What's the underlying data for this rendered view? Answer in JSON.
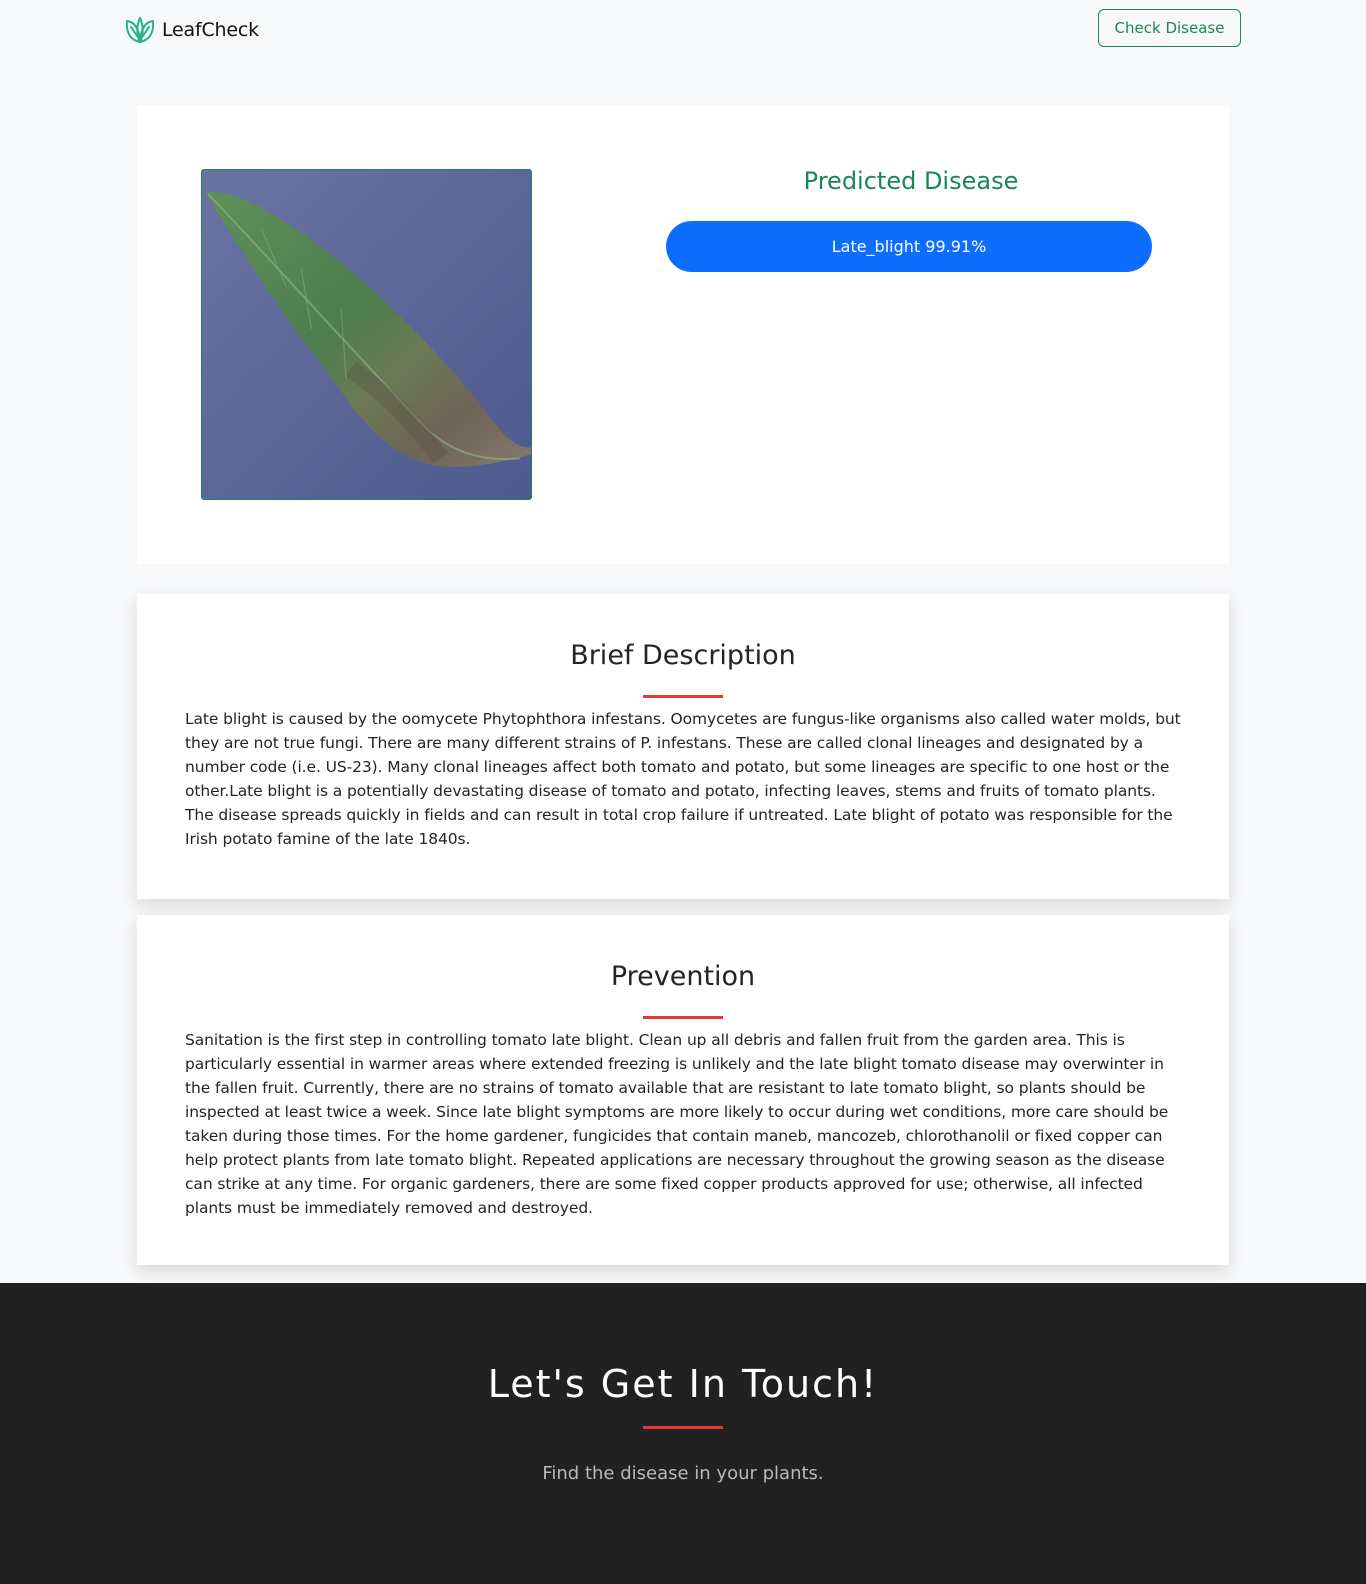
{
  "header": {
    "brand_name": "LeafCheck",
    "logo_icon": "leaf-logo-icon",
    "check_disease_label": "Check Disease"
  },
  "result": {
    "leaf_image": "leaf-photo",
    "predicted_title": "Predicted Disease",
    "prediction_label": "Late_blight 99.91%"
  },
  "description": {
    "title": "Brief Description",
    "text": "Late blight is caused by the oomycete Phytophthora infestans. Oomycetes are fungus-like organisms also called water molds, but they are not true fungi. There are many different strains of P. infestans. These are called clonal lineages and designated by a number code (i.e. US-23). Many clonal lineages affect both tomato and potato, but some lineages are specific to one host or the other.Late blight is a potentially devastating disease of tomato and potato, infecting leaves, stems and fruits of tomato plants. The disease spreads quickly in fields and can result in total crop failure if untreated. Late blight of potato was responsible for the Irish potato famine of the late 1840s."
  },
  "prevention": {
    "title": "Prevention",
    "text": "Sanitation is the first step in controlling tomato late blight. Clean up all debris and fallen fruit from the garden area. This is particularly essential in warmer areas where extended freezing is unlikely and the late blight tomato disease may overwinter in the fallen fruit. Currently, there are no strains of tomato available that are resistant to late tomato blight, so plants should be inspected at least twice a week. Since late blight symptoms are more likely to occur during wet conditions, more care should be taken during those times. For the home gardener, fungicides that contain maneb, mancozeb, chlorothanolil or fixed copper can help protect plants from late tomato blight. Repeated applications are necessary throughout the growing season as the disease can strike at any time. For organic gardeners, there are some fixed copper products approved for use; otherwise, all infected plants must be immediately removed and destroyed."
  },
  "footer": {
    "title": "Let's Get In Touch!",
    "subtitle": "Find the disease in your plants."
  },
  "colors": {
    "brand_green": "#198754",
    "primary_blue": "#0d6efd",
    "accent_red": "#e53935",
    "footer_bg": "#212121"
  }
}
